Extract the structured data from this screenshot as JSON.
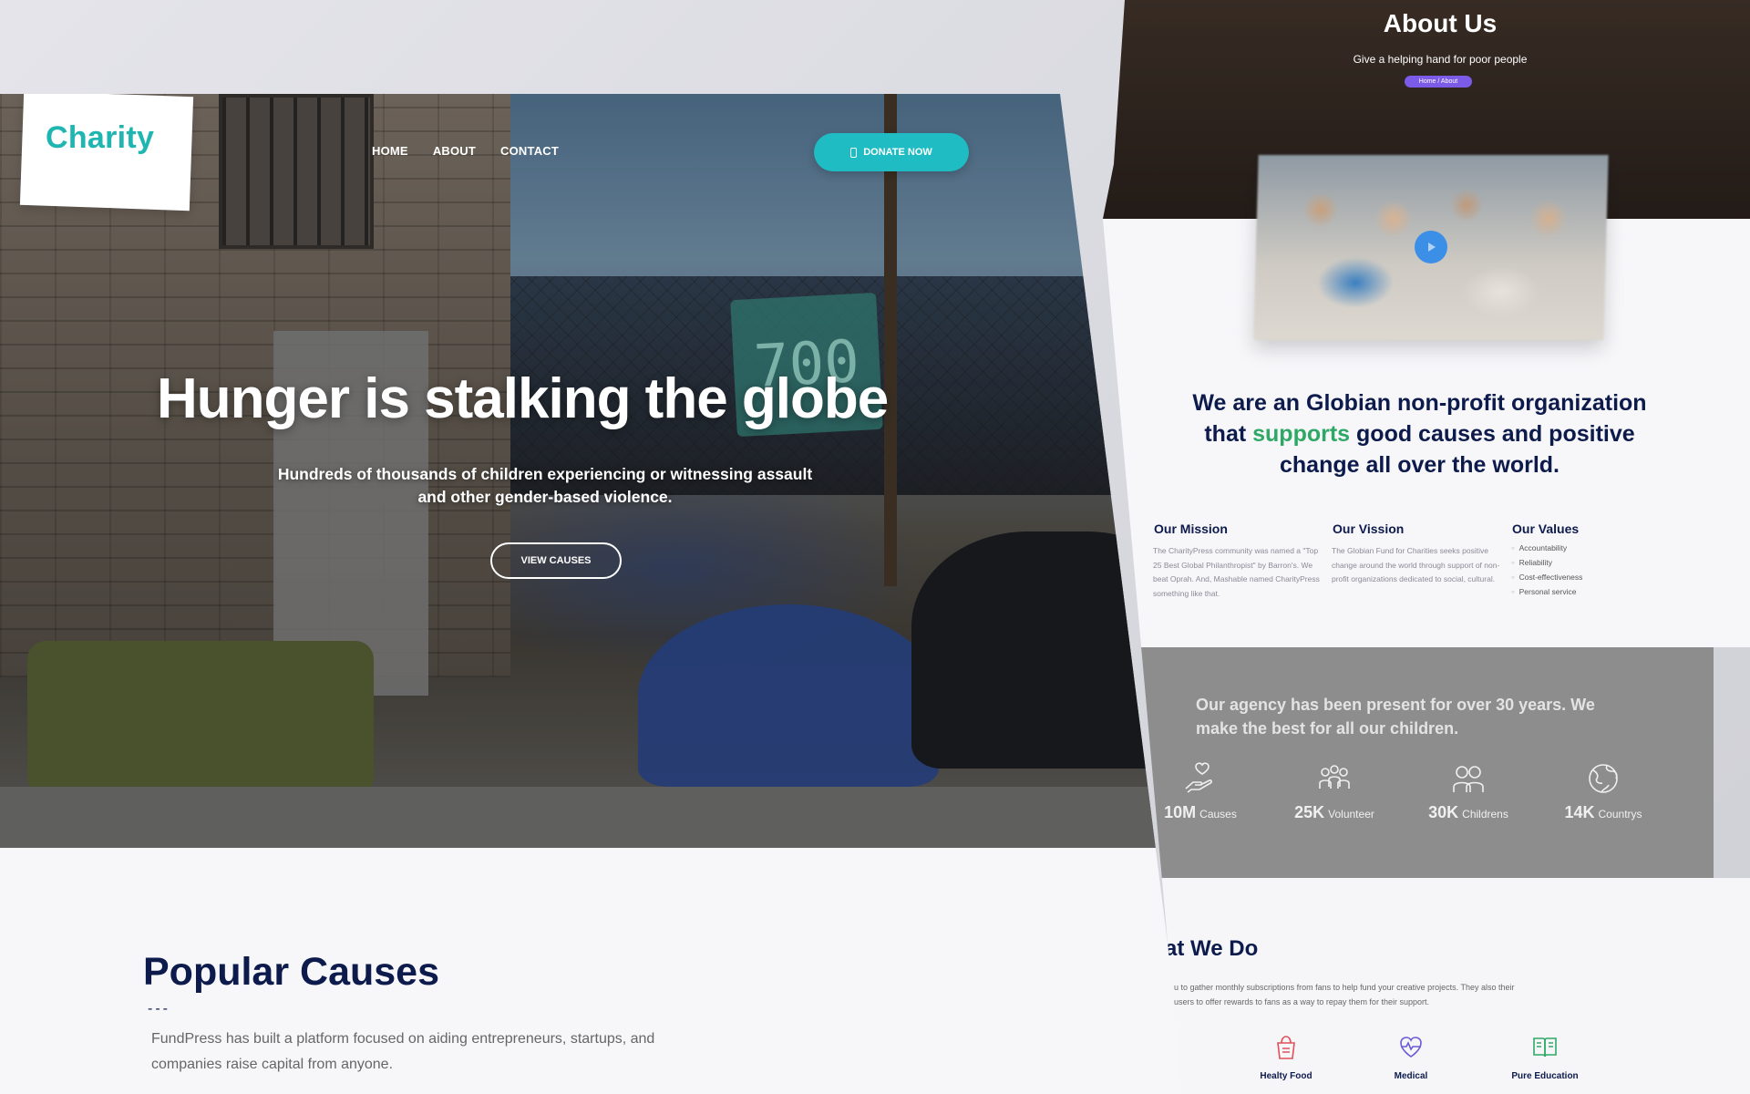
{
  "left_page": {
    "logo": "Charity",
    "nav": [
      "HOME",
      "ABOUT",
      "CONTACT"
    ],
    "donate_label": "DONATE NOW",
    "hero_sign": "700",
    "hero_title": "Hunger is stalking the globe",
    "hero_subtitle": "Hundreds of thousands of children experiencing or witnessing assault and other gender-based violence.",
    "view_causes_label": "VIEW CAUSES",
    "popular_causes": {
      "title": "Popular Causes",
      "dash": "---",
      "text": "FundPress has built a platform focused on aiding entrepreneurs, startups, and companies raise capital from anyone."
    }
  },
  "right_page": {
    "about_title": "About Us",
    "about_subtitle": "Give a helping hand for poor people",
    "breadcrumb": "Home / About",
    "org_statement": {
      "before": "We are an Globian non-profit organization that ",
      "highlight": "supports",
      "after": " good causes and positive change all over the world."
    },
    "mission": {
      "title": "Our Mission",
      "text": "The CharityPress community was named a \"Top 25 Best Global Philanthropist\" by Barron's. We beat Oprah. And, Mashable named CharityPress something like that."
    },
    "vision": {
      "title": "Our Vission",
      "text": "The Globian Fund for Charities seeks positive change around the world through support of non-profit organizations dedicated to social, cultural."
    },
    "values": {
      "title": "Our Values",
      "items": [
        "Accountability",
        "Reliability",
        "Cost-effectiveness",
        "Personal service"
      ]
    },
    "agency_text": "Our agency has been present for over 30 years. We make the best for all our children.",
    "stats": [
      {
        "value": "10M",
        "label": "Causes",
        "icon": "hand-heart-icon"
      },
      {
        "value": "25K",
        "label": "Volunteer",
        "icon": "group-icon"
      },
      {
        "value": "30K",
        "label": "Childrens",
        "icon": "children-icon"
      },
      {
        "value": "14K",
        "label": "Countrys",
        "icon": "globe-icon"
      }
    ],
    "what_we_do": {
      "title": "at We Do",
      "text": "u to gather monthly subscriptions from fans to help fund your creative projects. They also their users to offer rewards to fans as a way to repay them for their support."
    },
    "services": [
      {
        "label": "Healty Food",
        "icon": "food-bag-icon"
      },
      {
        "label": "Medical",
        "icon": "heart-pulse-icon"
      },
      {
        "label": "Pure Education",
        "icon": "book-icon"
      }
    ]
  },
  "colors": {
    "brand_teal": "#1fb5b0",
    "navy": "#0d1b4c",
    "highlight_green": "#2fa866",
    "breadcrumb_purple": "#7b5be8",
    "play_blue": "#3b8fe6",
    "stats_gray": "#8d8d8d"
  }
}
